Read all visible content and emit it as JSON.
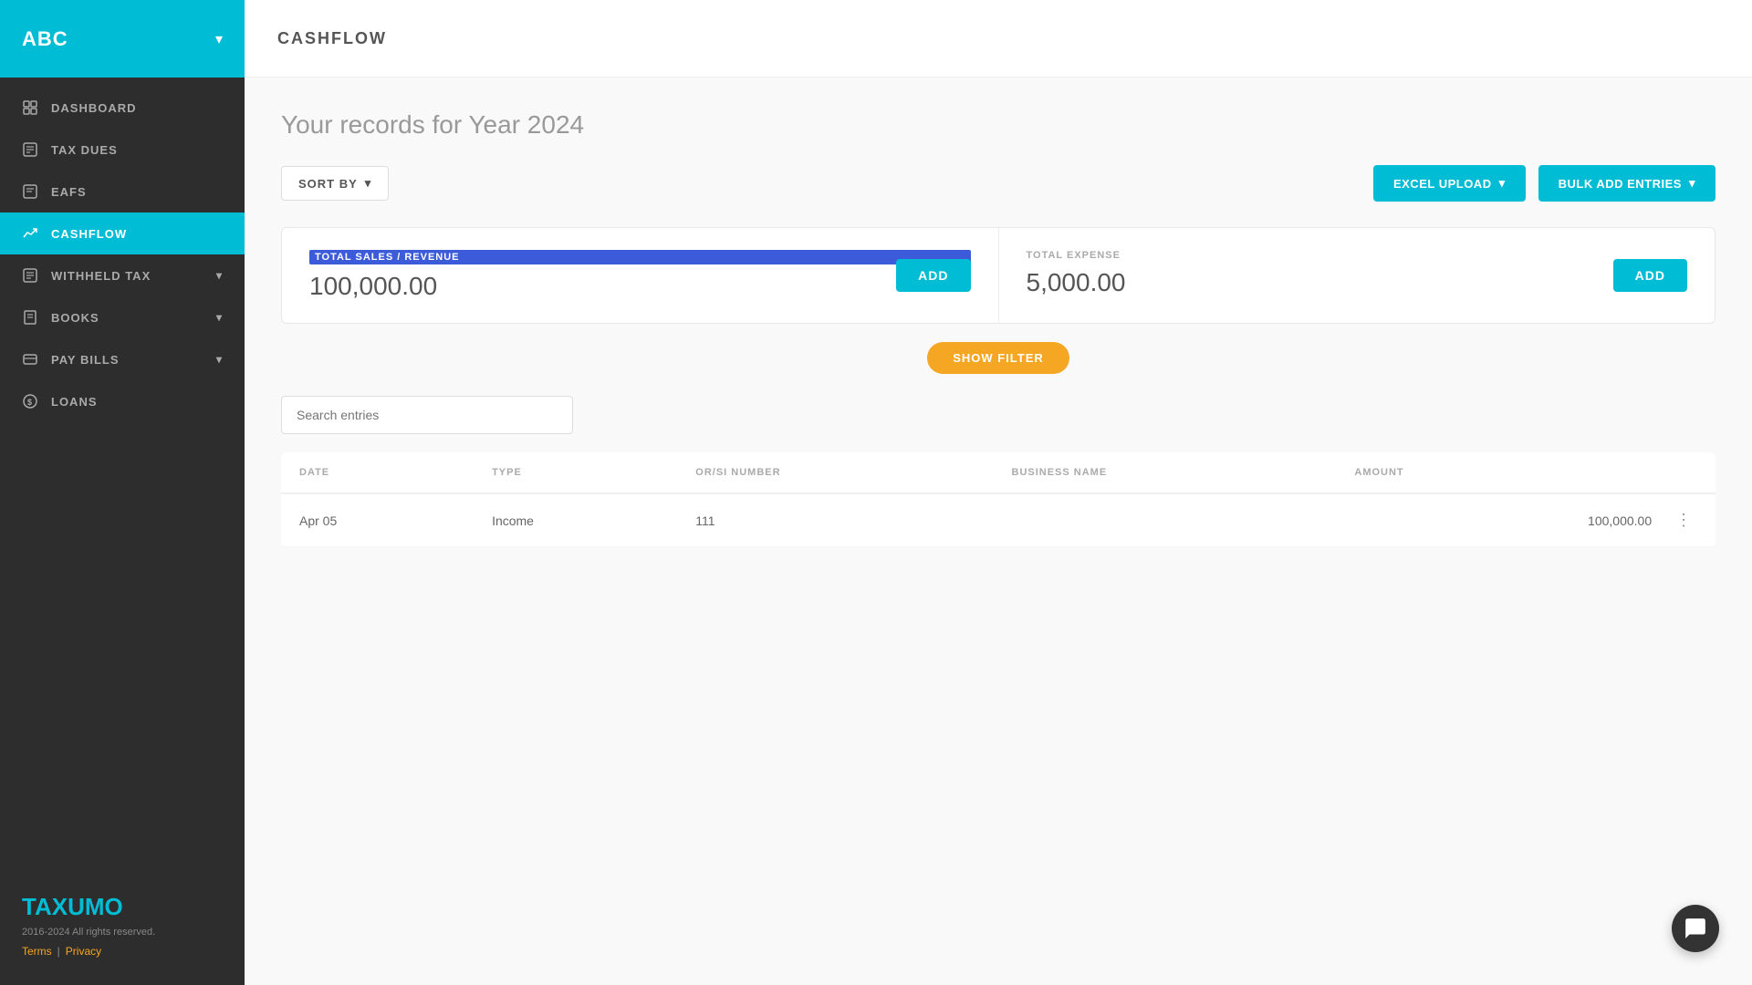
{
  "sidebar": {
    "company": "ABC",
    "chevron": "▾",
    "items": [
      {
        "id": "dashboard",
        "label": "Dashboard",
        "active": false,
        "hasChevron": false
      },
      {
        "id": "tax-dues",
        "label": "Tax Dues",
        "active": false,
        "hasChevron": false
      },
      {
        "id": "eafs",
        "label": "EAFS",
        "active": false,
        "hasChevron": false
      },
      {
        "id": "cashflow",
        "label": "Cashflow",
        "active": true,
        "hasChevron": false
      },
      {
        "id": "withheld-tax",
        "label": "Withheld Tax",
        "active": false,
        "hasChevron": true
      },
      {
        "id": "books",
        "label": "Books",
        "active": false,
        "hasChevron": true
      },
      {
        "id": "pay-bills",
        "label": "Pay Bills",
        "active": false,
        "hasChevron": true
      },
      {
        "id": "loans",
        "label": "Loans",
        "active": false,
        "hasChevron": false
      }
    ],
    "logo_tax": "TAX",
    "logo_umo": "UMO",
    "copyright": "2016-2024 All rights reserved.",
    "terms_label": "Terms",
    "privacy_label": "Privacy",
    "divider": "|"
  },
  "topbar": {
    "title": "CASHFLOW"
  },
  "content": {
    "heading": "Your records for Year 2024",
    "sort_by_label": "SORT BY",
    "sort_by_chevron": "▾",
    "excel_upload_label": "EXCEL UPLOAD",
    "excel_chevron": "▾",
    "bulk_add_label": "BULK ADD ENTRIES",
    "bulk_chevron": "▾",
    "total_sales_label": "TOTAL SALES / REVENUE",
    "total_sales_value": "100,000.00",
    "add_sales_label": "ADD",
    "total_expense_label": "TOTAL EXPENSE",
    "total_expense_value": "5,000.00",
    "add_expense_label": "ADD",
    "show_filter_label": "SHOW FILTER",
    "search_placeholder": "Search entries",
    "table": {
      "columns": [
        {
          "id": "date",
          "label": "DATE"
        },
        {
          "id": "type",
          "label": "TYPE"
        },
        {
          "id": "orsi_number",
          "label": "OR/SI NUMBER"
        },
        {
          "id": "business_name",
          "label": "BUSINESS NAME"
        },
        {
          "id": "amount",
          "label": "AMOUNT"
        }
      ],
      "rows": [
        {
          "date": "Apr 05",
          "type": "Income",
          "orsi_number": "111",
          "business_name": "",
          "amount": "100,000.00"
        }
      ]
    }
  }
}
